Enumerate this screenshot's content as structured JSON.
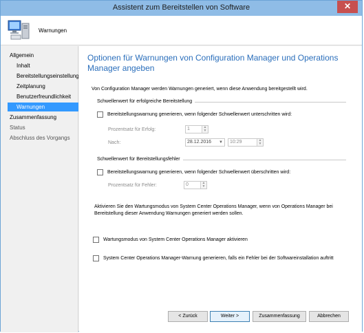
{
  "window": {
    "title": "Assistent zum Bereitstellen von Software",
    "close_glyph": "✕"
  },
  "header": {
    "title": "Warnungen",
    "icon": "computer-icon"
  },
  "sidebar": {
    "items": [
      {
        "label": "Allgemein",
        "level": "top",
        "state": "normal"
      },
      {
        "label": "Inhalt",
        "level": "sub",
        "state": "normal"
      },
      {
        "label": "Bereitstellungseinstellungen",
        "level": "sub",
        "state": "normal"
      },
      {
        "label": "Zeitplanung",
        "level": "sub",
        "state": "normal"
      },
      {
        "label": "Benutzerfreundlichkeit",
        "level": "sub",
        "state": "normal"
      },
      {
        "label": "Warnungen",
        "level": "sub",
        "state": "active"
      },
      {
        "label": "Zusammenfassung",
        "level": "top",
        "state": "normal"
      },
      {
        "label": "Status",
        "level": "top",
        "state": "muted"
      },
      {
        "label": "Abschluss des Vorgangs",
        "level": "top",
        "state": "muted"
      }
    ]
  },
  "main": {
    "heading": "Optionen für Warnungen von Configuration Manager und Operations Manager angeben",
    "intro": "Von Configuration Manager werden Warnungen generiert, wenn diese Anwendung bereitgestellt wird.",
    "success_group": {
      "label": "Schwellenwert für erfolgreiche Bereitstellung",
      "checkbox_label": "Bereitstellungswarnung generieren, wenn folgender Schwellenwert unterschritten wird:",
      "percent_label": "Prozentsatz für Erfolg:",
      "percent_value": "1",
      "after_label": "Nach:",
      "date_value": "28.12.2016",
      "time_value": "10:29"
    },
    "failure_group": {
      "label": "Schwellenwert für Bereitstellungsfehler",
      "checkbox_label": "Bereitstellungswarnung generieren, wenn folgender Schwellenwert überschritten wird:",
      "percent_label": "Prozentsatz für Fehler:",
      "percent_value": "0"
    },
    "ops_paragraph": "Aktivieren Sie den Wartungsmodus von System Center Operations Manager, wenn von Operations Manager bei Bereitstellung dieser Anwendung Warnungen generiert werden sollen.",
    "maintenance_checkbox_label": "Wartungsmodus von System Center Operations Manager aktivieren",
    "om_alert_checkbox_label": "System Center Operations Manager-Warnung generieren, falls ein Fehler bei der Softwareinstallation auftritt"
  },
  "buttons": {
    "back": "< Zurück",
    "next": "Weiter >",
    "summary": "Zusammenfassung",
    "cancel": "Abbrechen"
  }
}
